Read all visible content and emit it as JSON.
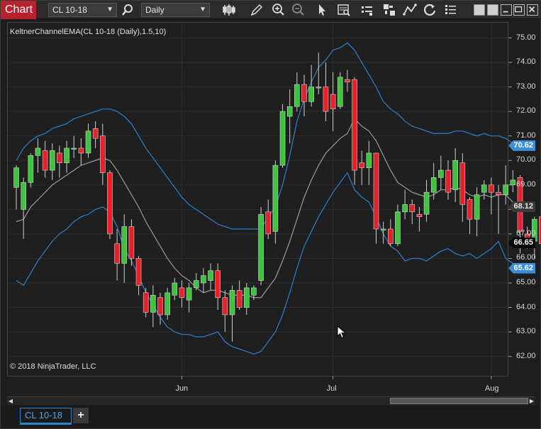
{
  "toolbar": {
    "brand": "Chart",
    "instrument": "CL 10-18",
    "interval": "Daily"
  },
  "indicator_label": "KeltnerChannelEMA(CL 10-18 (Daily),1.5,10)",
  "copyright": "© 2018 NinjaTrader, LLC",
  "price_axis": {
    "ticks": [
      "75.00",
      "74.00",
      "73.00",
      "72.00",
      "71.00",
      "70.00",
      "69.00",
      "68.00",
      "67.00",
      "66.00",
      "65.00",
      "64.00",
      "63.00",
      "62.00"
    ],
    "badges": [
      {
        "label": "70.62",
        "value": 70.62,
        "bg": "#3c8fd6",
        "fg": "#ffffff",
        "border": "#3c8fd6"
      },
      {
        "label": "68.12",
        "value": 68.12,
        "bg": "#3a3a3a",
        "fg": "#e6e6e6",
        "border": "#777777"
      },
      {
        "label": "66.65",
        "value": 66.65,
        "bg": "#050505",
        "fg": "#ffffff",
        "border": "#999999"
      },
      {
        "label": "65.62",
        "value": 65.62,
        "bg": "#3c8fd6",
        "fg": "#ffffff",
        "border": "#3c8fd6"
      }
    ]
  },
  "time_axis": {
    "labels": [
      {
        "text": "Jun",
        "bar_index": 23
      },
      {
        "text": "Jul",
        "bar_index": 44
      },
      {
        "text": "Aug",
        "bar_index": 66
      }
    ]
  },
  "tabs": {
    "active": "CL 10-18",
    "add": "+"
  },
  "colors": {
    "up": "#3cc43c",
    "down": "#e8202a",
    "wick": "#cfcfcf",
    "band": "#2f7fd0",
    "mid": "#9a9a9a",
    "grid": "#2c2c2c"
  },
  "chart_data": {
    "type": "candlestick",
    "title": "KeltnerChannelEMA(CL 10-18 (Daily),1.5,10)",
    "ylim": [
      61.6,
      75.6
    ],
    "x_tick_labels": [
      "Jun",
      "Jul",
      "Aug"
    ],
    "candles": [
      [
        68.9,
        69.7,
        68.0,
        69.8
      ],
      [
        68.0,
        69.1,
        66.8,
        69.3
      ],
      [
        69.1,
        70.2,
        68.9,
        70.3
      ],
      [
        70.2,
        70.5,
        69.5,
        70.9
      ],
      [
        70.4,
        69.6,
        69.3,
        70.8
      ],
      [
        69.6,
        70.4,
        69.2,
        70.7
      ],
      [
        70.3,
        69.9,
        69.3,
        70.6
      ],
      [
        69.9,
        70.5,
        69.5,
        70.8
      ],
      [
        70.5,
        70.5,
        70.1,
        71.0
      ],
      [
        70.5,
        70.3,
        69.8,
        70.9
      ],
      [
        70.3,
        71.2,
        70.1,
        71.5
      ],
      [
        71.3,
        70.9,
        70.5,
        71.6
      ],
      [
        71.0,
        69.5,
        69.0,
        71.5
      ],
      [
        69.5,
        67.0,
        66.8,
        69.6
      ],
      [
        66.6,
        65.8,
        65.1,
        67.2
      ],
      [
        65.8,
        67.3,
        65.0,
        67.8
      ],
      [
        67.3,
        66.0,
        65.7,
        67.6
      ],
      [
        66.0,
        64.9,
        64.5,
        66.1
      ],
      [
        64.6,
        63.8,
        63.6,
        64.8
      ],
      [
        63.8,
        64.5,
        63.2,
        64.9
      ],
      [
        64.4,
        63.7,
        63.3,
        64.6
      ],
      [
        63.7,
        64.6,
        63.5,
        64.8
      ],
      [
        64.5,
        65.0,
        64.3,
        65.2
      ],
      [
        64.8,
        64.4,
        64.0,
        65.1
      ],
      [
        64.3,
        64.8,
        63.8,
        65.0
      ],
      [
        64.8,
        65.1,
        64.7,
        65.4
      ],
      [
        65.0,
        65.3,
        64.6,
        65.6
      ],
      [
        65.1,
        65.5,
        64.7,
        65.8
      ],
      [
        65.5,
        64.4,
        63.9,
        65.8
      ],
      [
        64.4,
        63.7,
        63.0,
        64.7
      ],
      [
        63.7,
        64.7,
        62.6,
        64.9
      ],
      [
        64.7,
        64.0,
        63.9,
        65.1
      ],
      [
        64.0,
        64.8,
        63.7,
        65.0
      ],
      [
        64.5,
        64.8,
        64.3,
        64.9
      ],
      [
        65.1,
        67.8,
        64.9,
        68.1
      ],
      [
        67.9,
        67.0,
        66.8,
        68.4
      ],
      [
        67.1,
        69.8,
        66.6,
        70.0
      ],
      [
        69.8,
        72.0,
        69.7,
        72.3
      ],
      [
        71.8,
        72.2,
        70.7,
        72.9
      ],
      [
        72.2,
        73.1,
        72.0,
        73.6
      ],
      [
        73.1,
        72.4,
        71.8,
        73.5
      ],
      [
        72.4,
        73.0,
        72.2,
        73.9
      ],
      [
        73.0,
        73.0,
        72.7,
        74.4
      ],
      [
        73.0,
        72.0,
        71.6,
        74.0
      ],
      [
        72.7,
        72.1,
        71.2,
        73.6
      ],
      [
        72.2,
        73.4,
        72.1,
        73.6
      ],
      [
        73.3,
        73.2,
        72.8,
        73.7
      ],
      [
        73.3,
        69.6,
        69.0,
        73.4
      ],
      [
        69.9,
        69.7,
        69.0,
        70.4
      ],
      [
        69.7,
        70.3,
        69.0,
        70.8
      ],
      [
        70.3,
        67.2,
        66.6,
        70.3
      ],
      [
        67.2,
        67.2,
        66.6,
        67.5
      ],
      [
        67.2,
        66.6,
        66.5,
        67.6
      ],
      [
        66.6,
        67.9,
        66.5,
        68.2
      ],
      [
        67.9,
        68.2,
        67.6,
        68.8
      ],
      [
        68.2,
        67.9,
        67.4,
        68.4
      ],
      [
        67.8,
        67.7,
        67.1,
        68.1
      ],
      [
        67.8,
        68.7,
        67.5,
        69.2
      ],
      [
        68.7,
        69.3,
        68.4,
        69.9
      ],
      [
        69.3,
        69.6,
        68.8,
        70.2
      ],
      [
        69.6,
        68.7,
        68.4,
        70.0
      ],
      [
        68.8,
        70.0,
        68.3,
        70.5
      ],
      [
        69.9,
        68.2,
        67.5,
        70.3
      ],
      [
        68.4,
        67.6,
        67.0,
        68.5
      ],
      [
        67.6,
        68.6,
        66.9,
        68.9
      ],
      [
        68.7,
        69.0,
        68.4,
        69.2
      ],
      [
        69.0,
        68.7,
        67.8,
        69.3
      ],
      [
        68.7,
        68.6,
        67.0,
        69.0
      ],
      [
        68.6,
        69.0,
        68.2,
        69.8
      ],
      [
        69.0,
        69.2,
        68.7,
        69.6
      ],
      [
        69.3,
        67.1,
        66.2,
        69.4
      ],
      [
        67.0,
        66.7,
        66.4,
        67.3
      ],
      [
        66.7,
        67.6,
        66.0,
        67.7
      ],
      [
        67.7,
        66.6,
        66.3,
        67.9
      ]
    ],
    "series": [
      {
        "name": "Upper band",
        "values": [
          70.0,
          70.5,
          70.8,
          71.0,
          71.1,
          71.3,
          71.4,
          71.5,
          71.7,
          71.8,
          71.9,
          72.0,
          72.1,
          72.1,
          72.0,
          71.8,
          71.5,
          71.0,
          70.5,
          70.1,
          69.7,
          69.3,
          68.9,
          68.5,
          68.2,
          68.0,
          67.8,
          67.6,
          67.4,
          67.3,
          67.2,
          67.2,
          67.2,
          67.2,
          67.2,
          67.7,
          68.1,
          69.0,
          70.2,
          71.6,
          72.5,
          73.2,
          73.8,
          74.1,
          74.5,
          74.6,
          74.8,
          74.5,
          74.0,
          73.5,
          73.0,
          72.4,
          72.1,
          71.9,
          71.6,
          71.4,
          71.3,
          71.2,
          71.1,
          71.1,
          71.1,
          71.2,
          71.2,
          71.1,
          71.0,
          71.1,
          71.0,
          71.0,
          70.9,
          70.7,
          70.6
        ]
      },
      {
        "name": "Middle",
        "values": [
          67.5,
          67.6,
          68.1,
          68.4,
          68.7,
          69.0,
          69.2,
          69.4,
          69.6,
          69.8,
          69.9,
          70.0,
          70.1,
          70.0,
          69.6,
          69.1,
          68.6,
          68.1,
          67.5,
          67.0,
          66.5,
          66.0,
          65.6,
          65.3,
          65.1,
          64.8,
          64.6,
          64.7,
          64.7,
          64.6,
          64.5,
          64.5,
          64.5,
          64.4,
          64.4,
          64.8,
          65.2,
          65.9,
          66.7,
          67.6,
          68.5,
          69.2,
          69.8,
          70.3,
          70.6,
          70.9,
          71.1,
          71.7,
          71.4,
          71.2,
          70.8,
          70.2,
          69.6,
          69.1,
          68.9,
          68.7,
          68.6,
          68.5,
          68.6,
          68.8,
          68.8,
          68.9,
          68.8,
          68.6,
          68.5,
          68.6,
          68.5,
          68.6,
          68.6,
          68.3,
          68.1
        ]
      },
      {
        "name": "Lower band",
        "values": [
          65.1,
          64.9,
          65.4,
          65.9,
          66.3,
          66.7,
          67.0,
          67.2,
          67.5,
          67.7,
          67.8,
          68.0,
          68.1,
          67.9,
          67.3,
          66.4,
          65.9,
          65.3,
          64.6,
          64.1,
          63.6,
          63.2,
          63.0,
          62.9,
          62.9,
          62.8,
          62.8,
          62.9,
          63.0,
          62.6,
          62.4,
          62.3,
          62.2,
          62.1,
          62.2,
          62.6,
          63.0,
          63.7,
          64.6,
          65.6,
          66.5,
          67.1,
          67.7,
          68.2,
          68.7,
          69.1,
          69.5,
          68.8,
          68.5,
          68.3,
          67.7,
          67.0,
          66.5,
          66.3,
          65.9,
          66.0,
          66.0,
          65.9,
          66.1,
          66.3,
          66.4,
          66.2,
          66.1,
          66.2,
          66.0,
          66.2,
          66.4,
          66.7,
          66.0,
          65.8,
          65.6
        ]
      }
    ]
  }
}
